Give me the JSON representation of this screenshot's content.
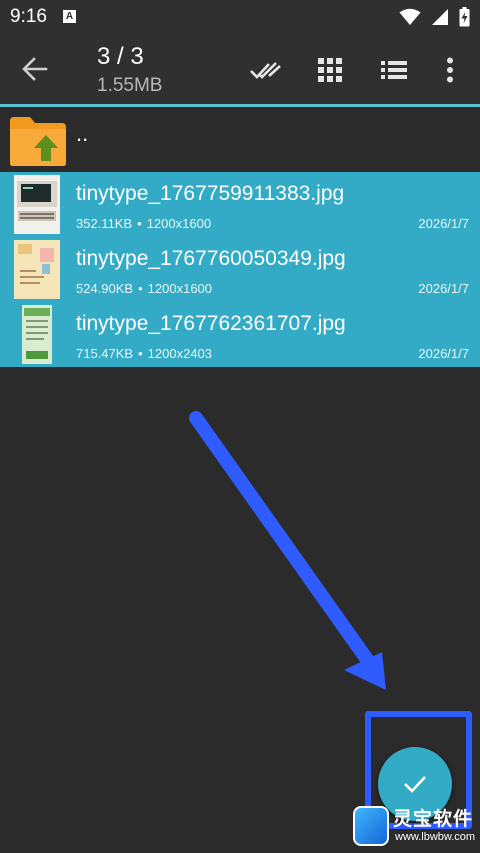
{
  "status_bar": {
    "time": "9:16",
    "app_icon_letter": "A"
  },
  "toolbar": {
    "selection_count": "3 / 3",
    "total_size": "1.55MB",
    "icons": [
      "back-arrow-icon",
      "select-all-icon",
      "grid-view-icon",
      "list-view-icon",
      "more-options-icon"
    ]
  },
  "parent_folder": {
    "label": ".."
  },
  "files": [
    {
      "name": "tinytype_1767759911383.jpg",
      "size": "352.11KB",
      "dimensions": "1200x1600",
      "date": "2026/1/7",
      "selected": true
    },
    {
      "name": "tinytype_1767760050349.jpg",
      "size": "524.90KB",
      "dimensions": "1200x1600",
      "date": "2026/1/7",
      "selected": true
    },
    {
      "name": "tinytype_1767762361707.jpg",
      "size": "715.47KB",
      "dimensions": "1200x2403",
      "date": "2026/1/7",
      "selected": true
    }
  ],
  "meta_separator": "•",
  "fab": {
    "icon": "checkmark-icon"
  },
  "watermark": {
    "title": "灵宝软件",
    "url": "www.lbwbw.com"
  },
  "colors": {
    "selection": "#33abc6",
    "accent_line": "#5ec4cf",
    "background": "#2b2b2b",
    "annotation": "#2f5cff"
  }
}
